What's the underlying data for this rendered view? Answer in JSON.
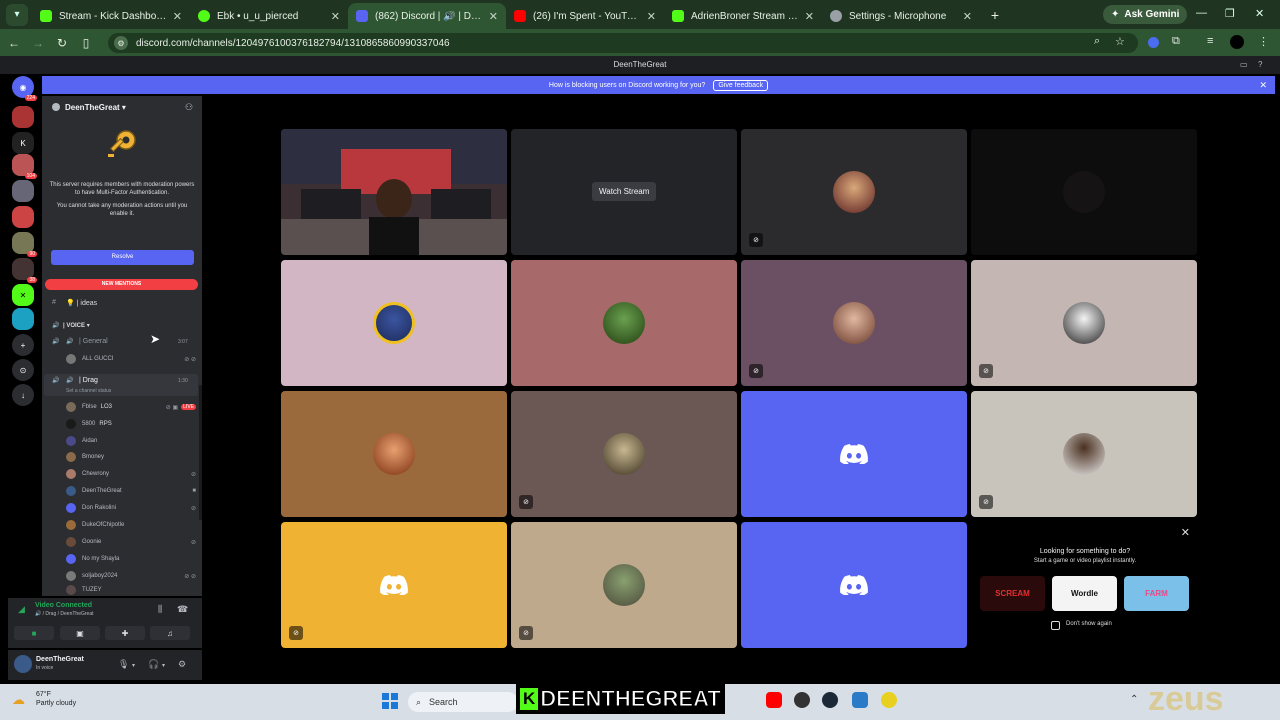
{
  "browser": {
    "tabs": [
      {
        "title": "Stream - Kick Dashboard",
        "color": "#53fc18"
      },
      {
        "title": "Ebk • u_u_pierced",
        "color": "#53fc18"
      },
      {
        "title": "(862) Discord | 🔊 | Drag | D",
        "color": "#5865f2",
        "active": true
      },
      {
        "title": "(26) I'm Spent - YouTube",
        "color": "#ff0000"
      },
      {
        "title": "AdrienBroner Stream - Watch L",
        "color": "#53fc18"
      },
      {
        "title": "Settings - Microphone",
        "color": "#9aa0a6"
      }
    ],
    "ask_gemini": "Ask Gemini",
    "url": "discord.com/channels/1204976100376182794/1310865860990337046"
  },
  "discord": {
    "window_title": "DeenTheGreat",
    "banner": {
      "text": "How is blocking users on Discord working for you?",
      "feedback": "Give feedback"
    },
    "server_badges": [
      "224",
      "104",
      "90",
      "38"
    ],
    "server_name": "DeenTheGreat",
    "mfa_text": "This server requires members with moderation powers to have Multi-Factor Authentication.",
    "mfa_text2": "You cannot take any moderation actions until you enable it.",
    "resolve": "Resolve",
    "new_mentions": "NEW MENTIONS",
    "channel_ideas": "💡 | ideas",
    "voice_category": "| VOICE",
    "channel_general": "| General",
    "general_time": "3:07",
    "general_member": "ALL GUCCI",
    "channel_drag": "| Drag",
    "drag_time": "1:30",
    "drag_status": "Set a channel status",
    "drag_members": [
      {
        "name": "Fblse",
        "extra": "LO3",
        "live": "LIVE",
        "color": "#7a6a5a"
      },
      {
        "name": "5800",
        "extra": "RPS",
        "color": "#1a1a1a"
      },
      {
        "name": "Aidan",
        "color": "#4a4a8a"
      },
      {
        "name": "Bmoney",
        "color": "#8a6a4a"
      },
      {
        "name": "Chewrony",
        "color": "#aa7a6a"
      },
      {
        "name": "DeenTheGreat",
        "color": "#3a5a8a"
      },
      {
        "name": "Don Rakolini",
        "color": "#5865f2"
      },
      {
        "name": "DukeOfChipotle",
        "color": "#9a6a3a"
      },
      {
        "name": "Goonie",
        "color": "#6a4a3a"
      },
      {
        "name": "No my Shayla",
        "color": "#5865f2"
      },
      {
        "name": "soljaboy2024",
        "color": "#7a7a7a"
      },
      {
        "name": "TUZEY",
        "color": "#5a4a4a"
      }
    ],
    "video_connected": "Video Connected",
    "voice_location": "Drag / DeenTheGreat",
    "user_name": "DeenTheGreat",
    "user_status": "In voice",
    "watch_stream": "Watch Stream",
    "activity": {
      "title": "Looking for something to do?",
      "subtitle": "Start a game or video playlist instantly.",
      "games": [
        "SCREAM",
        "Wordle",
        "FARM"
      ],
      "dont_show": "Don't show again"
    }
  },
  "taskbar": {
    "temp": "67°F",
    "weather": "Partly cloudy",
    "search": "Search",
    "overlay_k": "K",
    "overlay_name": "DEENTHEGREAT",
    "watermark": "zeus"
  }
}
